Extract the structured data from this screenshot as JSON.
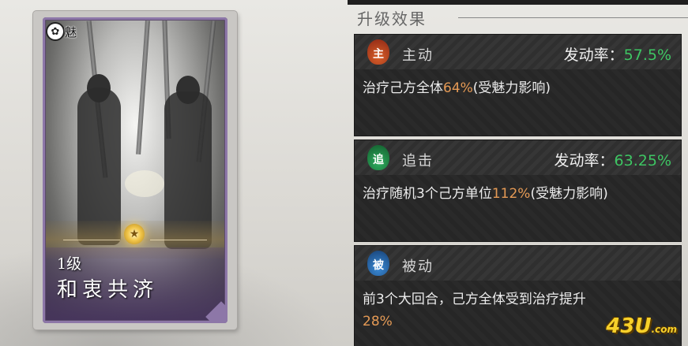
{
  "card": {
    "faction": "魅",
    "faction_emblem": "✿",
    "level": "1级",
    "title": "和衷共济",
    "star": "★"
  },
  "panel": {
    "title": "升级效果"
  },
  "skills": [
    {
      "icon_char": "主",
      "icon_color": "#c0431f",
      "type": "主动",
      "rate_label": "发动率：",
      "rate_value": "57.5%",
      "desc_pre": "治疗己方全体",
      "desc_hl": "64%",
      "desc_post": "(受魅力影响)"
    },
    {
      "icon_char": "追",
      "icon_color": "#1f8f4a",
      "type": "追击",
      "rate_label": "发动率：",
      "rate_value": "63.25%",
      "desc_pre": "治疗随机3个己方单位",
      "desc_hl": "112%",
      "desc_post": "(受魅力影响)"
    },
    {
      "icon_char": "被",
      "icon_color": "#2a6fb8",
      "type": "被动",
      "desc_pre": "前3个大回合，己方全体受到治疗提升",
      "desc_hl": "28%",
      "desc_post": ""
    }
  ],
  "watermark": {
    "main": "43U",
    "suffix": ".com"
  },
  "colors": {
    "rate_value": "#3ec563",
    "highlight": "#e59a55",
    "card_border": "#8d77a8",
    "panel_bg": "#262626"
  }
}
